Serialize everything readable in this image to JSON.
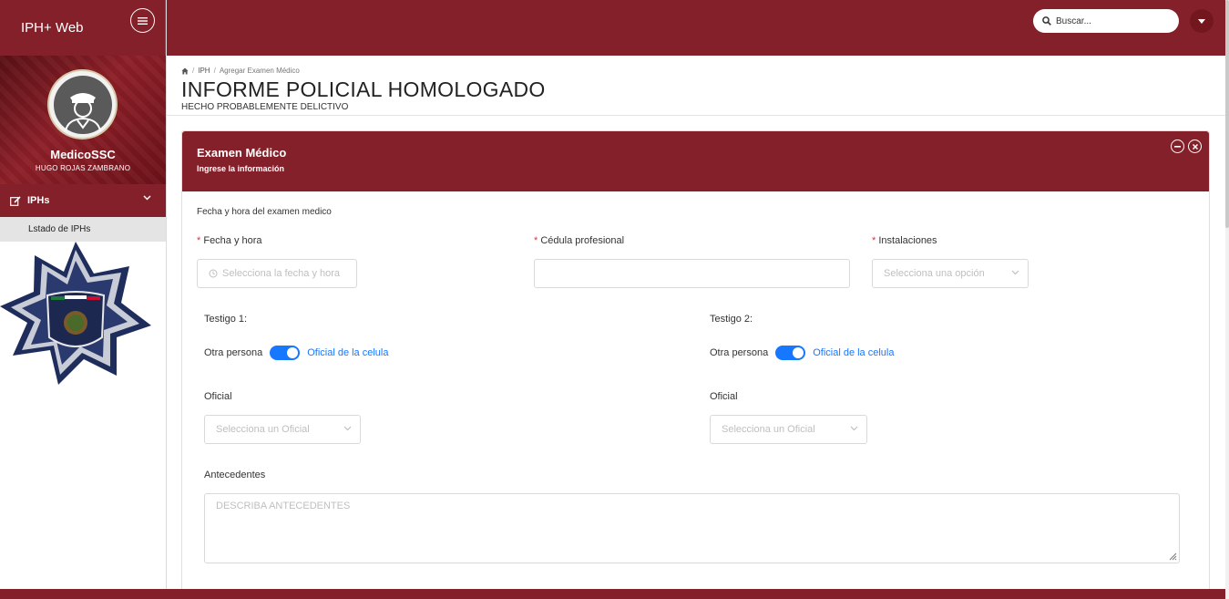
{
  "app": {
    "title": "IPH+ Web"
  },
  "user": {
    "role": "MedicoSSC",
    "full_name": "HUGO ROJAS ZAMBRANO"
  },
  "sidebar": {
    "group_label": "IPHs",
    "items": [
      {
        "label": "Lstado de IPHs"
      }
    ]
  },
  "topbar": {
    "search_placeholder": "Buscar..."
  },
  "breadcrumb": {
    "root": "IPH",
    "current": "Agregar Examen Médico"
  },
  "page": {
    "title": "INFORME POLICIAL HOMOLOGADO",
    "subtitle": "HECHO PROBABLEMENTE DELICTIVO"
  },
  "card": {
    "title": "Examen Médico",
    "subtitle": "Ingrese la información",
    "section_label": "Fecha y hora del examen medico",
    "fields": {
      "fecha": {
        "label": "Fecha y hora",
        "placeholder": "Selecciona la fecha y hora"
      },
      "cedula": {
        "label": "Cédula profesional",
        "value": ""
      },
      "instalaciones": {
        "label": "Instalaciones",
        "placeholder": "Selecciona una opción"
      }
    },
    "testigo1": {
      "label": "Testigo 1:",
      "switch_off_label": "Otra persona",
      "switch_on_label": "Oficial de la celula",
      "oficial_label": "Oficial",
      "oficial_placeholder": "Selecciona un Oficial"
    },
    "testigo2": {
      "label": "Testigo 2:",
      "switch_off_label": "Otra persona",
      "switch_on_label": "Oficial de la celula",
      "oficial_label": "Oficial",
      "oficial_placeholder": "Selecciona un Oficial"
    },
    "antecedentes": {
      "label": "Antecedentes",
      "placeholder": "DESCRIBA ANTECEDENTES"
    }
  },
  "colors": {
    "brand": "#842029",
    "accent": "#1677ff",
    "required": "#d9363e"
  }
}
